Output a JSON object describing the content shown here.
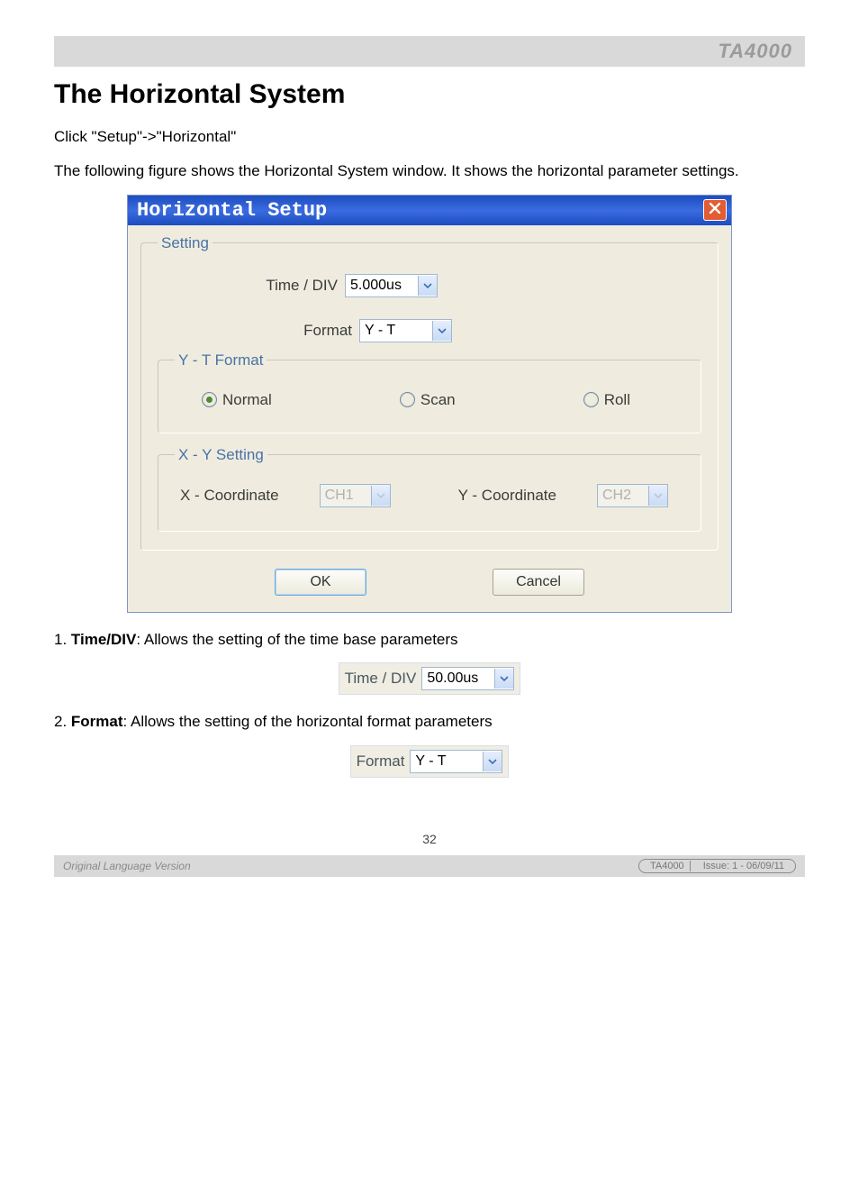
{
  "header": {
    "product": "TA4000"
  },
  "heading": "The Horizontal System",
  "intro1": "Click \"Setup\"->\"Horizontal\"",
  "intro2": "The following figure shows the Horizontal System window. It shows the horizontal parameter settings.",
  "dialog": {
    "title": "Horizontal Setup",
    "group_setting": "Setting",
    "time_div_label": "Time / DIV",
    "time_div_value": "5.000us",
    "format_label": "Format",
    "format_value": "Y - T",
    "group_yt": "Y - T Format",
    "radio_normal": "Normal",
    "radio_scan": "Scan",
    "radio_roll": "Roll",
    "group_xy": "X - Y Setting",
    "x_label": "X - Coordinate",
    "x_value": "CH1",
    "y_label": "Y - Coordinate",
    "y_value": "CH2",
    "ok": "OK",
    "cancel": "Cancel"
  },
  "item1_prefix": "1. ",
  "item1_bold": "Time/DIV",
  "item1_rest": ": Allows the setting of the time base parameters",
  "fig1_label": "Time / DIV",
  "fig1_value": "50.00us",
  "item2_prefix": "2. ",
  "item2_bold": "Format",
  "item2_rest": ": Allows the setting of the horizontal format parameters",
  "fig2_label": "Format",
  "fig2_value": "Y - T",
  "footer": {
    "page": "32",
    "olt": "Original Language Version",
    "pill_model": "TA4000",
    "pill_issue": "Issue: 1 - 06/09/11"
  }
}
